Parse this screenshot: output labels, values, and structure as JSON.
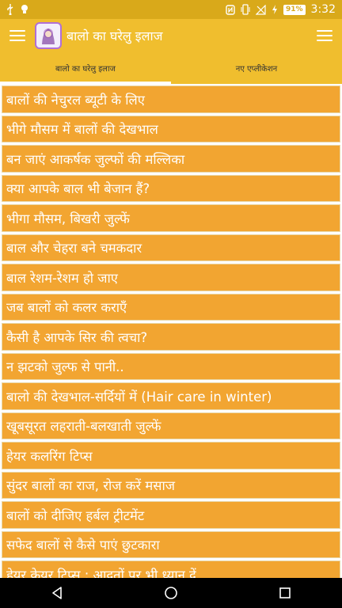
{
  "status_bar": {
    "battery": "91%",
    "time": "3:32"
  },
  "app_bar": {
    "title": "बालो का घरेलु इलाज",
    "logo_text": "बालो का घरेलु इलाज"
  },
  "tabs": [
    {
      "label": "बालो का घरेलु इलाज",
      "active": true
    },
    {
      "label": "नए एप्लीकेशन",
      "active": false
    }
  ],
  "list": {
    "items": [
      "बालों की नेचुरल ब्यूटी के लिए",
      "भीगे मौसम में बालों की देखभाल",
      "बन जाएं आकर्षक जुल्फों की मल्लिका",
      "क्या आपके बाल भी बेजान हैं?",
      "भीगा मौसम, बिखरी जुल्फें",
      "बाल और चेहरा बने चमकदार",
      "बाल रेशम-रेशम हो जाए",
      "जब बालों को कलर कराएँ",
      "कैसी है आपके सिर की त्वचा?",
      "न झटको जुल्फ से पानी..",
      "बालो की देखभाल-सर्दियों में (Hair care in winter)",
      "खूबसूरत लहराती-बलखाती जुल्फें",
      "हेयर कलरिंग टिप्स",
      "सुंदर बालों का राज, रोज करें मसाज",
      "बालों को दीजिए हर्बल ट्रीटमेंट",
      "सफेद बालों से कैसे पाएं छुटकारा",
      "हेयर केयर टिप्स : आदतों पर भी ध्यान दें"
    ]
  },
  "colors": {
    "status_bar": "#d9a91a",
    "app_bar": "#f0be2e",
    "list_item": "#f2a531",
    "nav_bar": "#000000"
  }
}
